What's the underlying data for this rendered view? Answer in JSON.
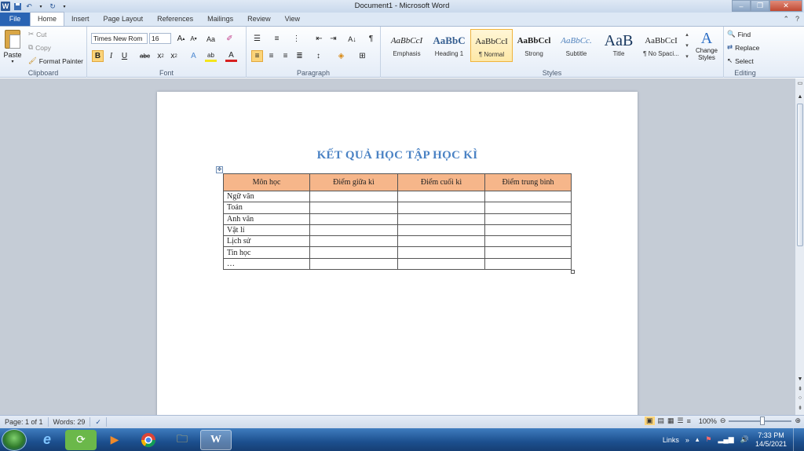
{
  "window": {
    "title": "Document1 - Microsoft Word",
    "controls": [
      "–",
      "❐",
      "✕"
    ]
  },
  "quick_access": {
    "save_icon": "save-icon",
    "undo_icon": "undo-icon",
    "redo_icon": "redo-icon",
    "logo": "W"
  },
  "tabs": [
    {
      "label": "File"
    },
    {
      "label": "Home"
    },
    {
      "label": "Insert"
    },
    {
      "label": "Page Layout"
    },
    {
      "label": "References"
    },
    {
      "label": "Mailings"
    },
    {
      "label": "Review"
    },
    {
      "label": "View"
    }
  ],
  "ribbon": {
    "clipboard": {
      "label": "Clipboard",
      "paste": "Paste",
      "cut": "Cut",
      "copy": "Copy",
      "format_painter": "Format Painter"
    },
    "font": {
      "label": "Font",
      "font_name": "Times New Rom",
      "font_size": "16"
    },
    "paragraph": {
      "label": "Paragraph"
    },
    "styles": {
      "label": "Styles",
      "items": [
        {
          "preview": "AaBbCcI",
          "name": "Emphasis"
        },
        {
          "preview": "AaBbC",
          "name": "Heading 1"
        },
        {
          "preview": "AaBbCcI",
          "name": "¶ Normal"
        },
        {
          "preview": "AaBbCcl",
          "name": "Strong"
        },
        {
          "preview": "AaBbCc.",
          "name": "Subtitle"
        },
        {
          "preview": "AaB",
          "name": "Title"
        },
        {
          "preview": "AaBbCcI",
          "name": "¶ No Spaci..."
        }
      ],
      "change_styles": "Change Styles"
    },
    "editing": {
      "label": "Editing",
      "find": "Find",
      "replace": "Replace",
      "select": "Select"
    }
  },
  "document": {
    "heading": "KẾT QUẢ HỌC TẬP HỌC KÌ",
    "table": {
      "headers": [
        "Môn học",
        "Điểm giữa kì",
        "Điểm cuối kì",
        "Điểm trung bình"
      ],
      "rows": [
        "Ngữ văn",
        "Toán",
        "Anh văn",
        "Vật lí",
        "Lịch sử",
        "Tin học",
        "…"
      ]
    }
  },
  "status": {
    "page": "Page: 1 of 1",
    "words": "Words: 29",
    "zoom": "100%"
  },
  "taskbar": {
    "links": "Links",
    "time": "7:33 PM",
    "date": "14/5/2021"
  },
  "colors": {
    "accent": "#2a64b4",
    "heading": "#4a82c4",
    "table_header": "#f6b68a"
  }
}
